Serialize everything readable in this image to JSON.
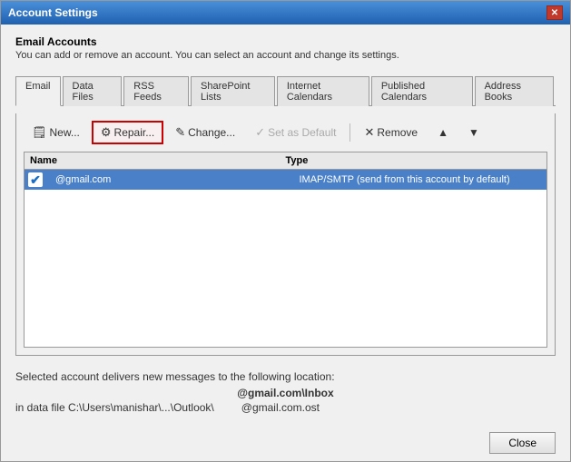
{
  "window": {
    "title": "Account Settings",
    "close_label": "✕"
  },
  "header": {
    "title": "Email Accounts",
    "description": "You can add or remove an account. You can select an account and change its settings."
  },
  "tabs": [
    {
      "id": "email",
      "label": "Email",
      "active": true
    },
    {
      "id": "data-files",
      "label": "Data Files",
      "active": false
    },
    {
      "id": "rss-feeds",
      "label": "RSS Feeds",
      "active": false
    },
    {
      "id": "sharepoint-lists",
      "label": "SharePoint Lists",
      "active": false
    },
    {
      "id": "internet-calendars",
      "label": "Internet Calendars",
      "active": false
    },
    {
      "id": "published-calendars",
      "label": "Published Calendars",
      "active": false
    },
    {
      "id": "address-books",
      "label": "Address Books",
      "active": false
    }
  ],
  "toolbar": {
    "new_label": "New...",
    "repair_label": "Repair...",
    "change_label": "Change...",
    "set_default_label": "Set as Default",
    "remove_label": "Remove",
    "move_up_label": "▲",
    "move_down_label": "▼"
  },
  "table": {
    "col_name": "Name",
    "col_type": "Type",
    "rows": [
      {
        "icon": "✔",
        "name": "@gmail.com",
        "type": "IMAP/SMTP (send from this account by default)"
      }
    ]
  },
  "footer": {
    "info_text": "Selected account delivers new messages to the following location:",
    "inbox_label": "@gmail.com\\Inbox",
    "data_file_label": "in data file C:\\Users\\manishar\\...\\Outlook\\",
    "ost_label": "@gmail.com.ost"
  },
  "bottom": {
    "close_label": "Close"
  }
}
